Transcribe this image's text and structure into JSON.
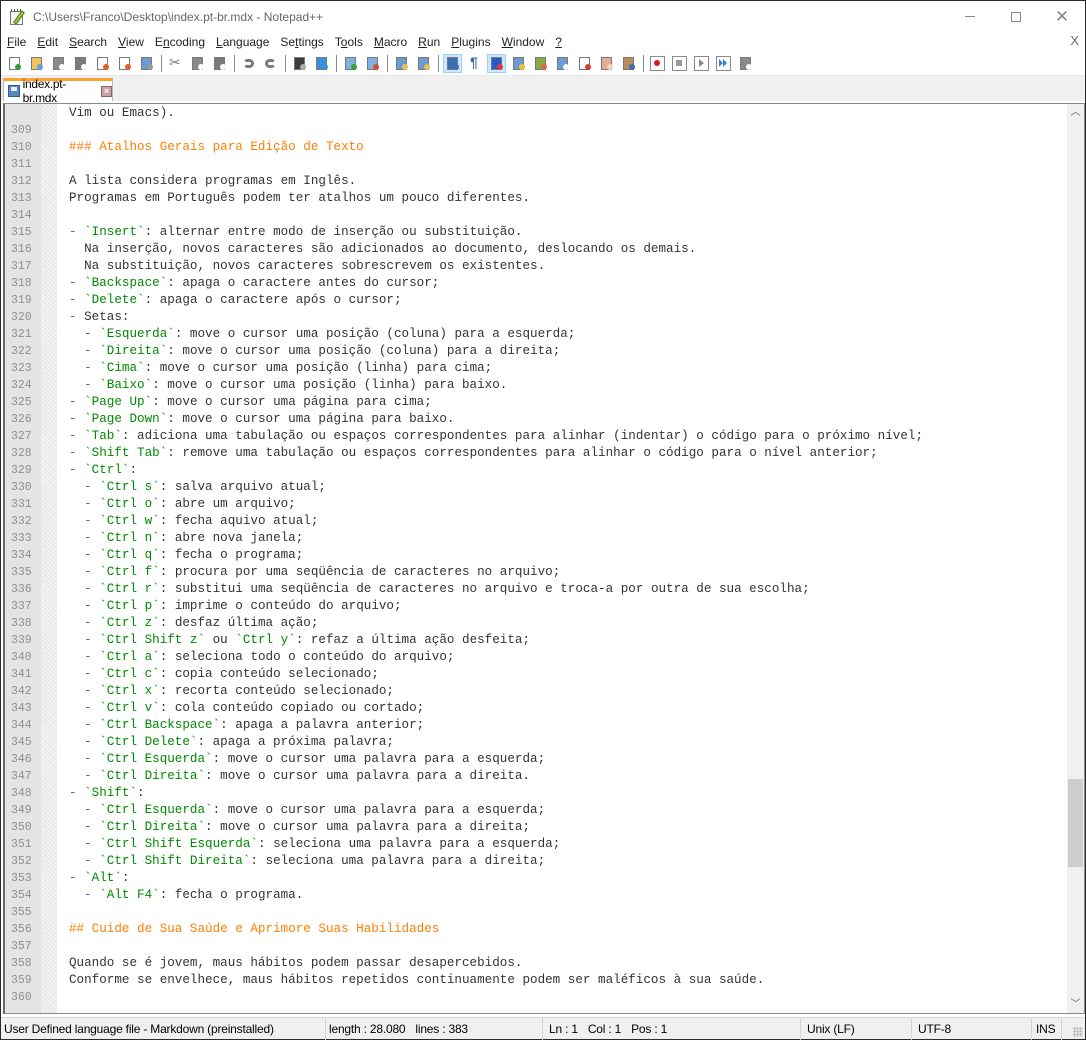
{
  "window": {
    "title": "C:\\Users\\Franco\\Desktop\\index.pt-br.mdx - Notepad++",
    "controls": [
      "minimize",
      "maximize",
      "close"
    ]
  },
  "menubar": {
    "items": [
      {
        "label": "File",
        "key": "F"
      },
      {
        "label": "Edit",
        "key": "E"
      },
      {
        "label": "Search",
        "key": "S"
      },
      {
        "label": "View",
        "key": "V"
      },
      {
        "label": "Encoding",
        "key": "n"
      },
      {
        "label": "Language",
        "key": "L"
      },
      {
        "label": "Settings",
        "key": "t"
      },
      {
        "label": "Tools",
        "key": "o"
      },
      {
        "label": "Macro",
        "key": "M"
      },
      {
        "label": "Run",
        "key": "R"
      },
      {
        "label": "Plugins",
        "key": "P"
      },
      {
        "label": "Window",
        "key": "W"
      },
      {
        "label": "?",
        "key": "?"
      }
    ],
    "close_label": "X"
  },
  "toolbar": {
    "groups": [
      [
        "new-file",
        "open-file",
        "save",
        "save-all",
        "close",
        "close-all",
        "print"
      ],
      [
        "cut",
        "copy",
        "paste"
      ],
      [
        "undo",
        "redo"
      ],
      [
        "find",
        "replace"
      ],
      [
        "zoom-in",
        "zoom-out"
      ],
      [
        "sync-vertical",
        "sync-horizontal"
      ],
      [
        "word-wrap",
        "show-all-characters",
        "indent-guide",
        "user-defined-language",
        "document-map",
        "document-list",
        "function-list",
        "folder-as-workspace",
        "monitoring"
      ],
      [
        "record-macro",
        "stop-recording",
        "playback-macro",
        "run-macro-multiple",
        "save-macro"
      ]
    ],
    "active": [
      "word-wrap",
      "indent-guide"
    ]
  },
  "tabs": [
    {
      "label": "index.pt-br.mdx",
      "icon": "save-icon",
      "active": true
    }
  ],
  "editor": {
    "colors": {
      "heading": "#ff7f00",
      "code": "#008a00",
      "dash": "#5b54d9",
      "text": "#222222",
      "line_number": "#8f8f8f"
    },
    "lines": [
      {
        "n": "",
        "tokens": [
          {
            "t": "p",
            "v": "Vim ou Emacs)."
          }
        ]
      },
      {
        "n": "309",
        "tokens": []
      },
      {
        "n": "310",
        "tokens": [
          {
            "t": "h",
            "v": "### Atalhos Gerais para Edição de Texto"
          }
        ]
      },
      {
        "n": "311",
        "tokens": []
      },
      {
        "n": "312",
        "tokens": [
          {
            "t": "p",
            "v": "A lista considera programas em Inglês."
          }
        ]
      },
      {
        "n": "313",
        "tokens": [
          {
            "t": "p",
            "v": "Programas em Português podem ter atalhos um pouco diferentes."
          }
        ]
      },
      {
        "n": "314",
        "tokens": []
      },
      {
        "n": "315",
        "tokens": [
          {
            "t": "d",
            "v": "- "
          },
          {
            "t": "c",
            "v": "`Insert`"
          },
          {
            "t": "p",
            "v": ": alternar entre modo de inserção ou substituição."
          }
        ]
      },
      {
        "n": "316",
        "tokens": [
          {
            "t": "p",
            "v": "  Na inserção, novos caracteres são adicionados ao documento, deslocando os demais."
          }
        ]
      },
      {
        "n": "317",
        "tokens": [
          {
            "t": "p",
            "v": "  Na substituição, novos caracteres sobrescrevem os existentes."
          }
        ]
      },
      {
        "n": "318",
        "tokens": [
          {
            "t": "d",
            "v": "- "
          },
          {
            "t": "c",
            "v": "`Backspace`"
          },
          {
            "t": "p",
            "v": ": apaga o caractere antes do cursor;"
          }
        ]
      },
      {
        "n": "319",
        "tokens": [
          {
            "t": "d",
            "v": "- "
          },
          {
            "t": "c",
            "v": "`Delete`"
          },
          {
            "t": "p",
            "v": ": apaga o caractere após o cursor;"
          }
        ]
      },
      {
        "n": "320",
        "tokens": [
          {
            "t": "d",
            "v": "- "
          },
          {
            "t": "p",
            "v": "Setas:"
          }
        ]
      },
      {
        "n": "321",
        "tokens": [
          {
            "t": "d",
            "v": "  - "
          },
          {
            "t": "c",
            "v": "`Esquerda`"
          },
          {
            "t": "p",
            "v": ": move o cursor uma posição (coluna) para a esquerda;"
          }
        ]
      },
      {
        "n": "322",
        "tokens": [
          {
            "t": "d",
            "v": "  - "
          },
          {
            "t": "c",
            "v": "`Direita`"
          },
          {
            "t": "p",
            "v": ": move o cursor uma posição (coluna) para a direita;"
          }
        ]
      },
      {
        "n": "323",
        "tokens": [
          {
            "t": "d",
            "v": "  - "
          },
          {
            "t": "c",
            "v": "`Cima`"
          },
          {
            "t": "p",
            "v": ": move o cursor uma posição (linha) para cima;"
          }
        ]
      },
      {
        "n": "324",
        "tokens": [
          {
            "t": "d",
            "v": "  - "
          },
          {
            "t": "c",
            "v": "`Baixo`"
          },
          {
            "t": "p",
            "v": ": move o cursor uma posição (linha) para baixo."
          }
        ]
      },
      {
        "n": "325",
        "tokens": [
          {
            "t": "d",
            "v": "- "
          },
          {
            "t": "c",
            "v": "`Page Up`"
          },
          {
            "t": "p",
            "v": ": move o cursor uma página para cima;"
          }
        ]
      },
      {
        "n": "326",
        "tokens": [
          {
            "t": "d",
            "v": "- "
          },
          {
            "t": "c",
            "v": "`Page Down`"
          },
          {
            "t": "p",
            "v": ": move o cursor uma página para baixo."
          }
        ]
      },
      {
        "n": "327",
        "tokens": [
          {
            "t": "d",
            "v": "- "
          },
          {
            "t": "c",
            "v": "`Tab`"
          },
          {
            "t": "p",
            "v": ": adiciona uma tabulação ou espaços correspondentes para alinhar (indentar) o código para o próximo nível;"
          }
        ]
      },
      {
        "n": "328",
        "tokens": [
          {
            "t": "d",
            "v": "- "
          },
          {
            "t": "c",
            "v": "`Shift Tab`"
          },
          {
            "t": "p",
            "v": ": remove uma tabulação ou espaços correspondentes para alinhar o código para o nível anterior;"
          }
        ]
      },
      {
        "n": "329",
        "tokens": [
          {
            "t": "d",
            "v": "- "
          },
          {
            "t": "c",
            "v": "`Ctrl`"
          },
          {
            "t": "p",
            "v": ":"
          }
        ]
      },
      {
        "n": "330",
        "tokens": [
          {
            "t": "d",
            "v": "  - "
          },
          {
            "t": "c",
            "v": "`Ctrl s`"
          },
          {
            "t": "p",
            "v": ": salva arquivo atual;"
          }
        ]
      },
      {
        "n": "331",
        "tokens": [
          {
            "t": "d",
            "v": "  - "
          },
          {
            "t": "c",
            "v": "`Ctrl o`"
          },
          {
            "t": "p",
            "v": ": abre um arquivo;"
          }
        ]
      },
      {
        "n": "332",
        "tokens": [
          {
            "t": "d",
            "v": "  - "
          },
          {
            "t": "c",
            "v": "`Ctrl w`"
          },
          {
            "t": "p",
            "v": ": fecha aquivo atual;"
          }
        ]
      },
      {
        "n": "333",
        "tokens": [
          {
            "t": "d",
            "v": "  - "
          },
          {
            "t": "c",
            "v": "`Ctrl n`"
          },
          {
            "t": "p",
            "v": ": abre nova janela;"
          }
        ]
      },
      {
        "n": "334",
        "tokens": [
          {
            "t": "d",
            "v": "  - "
          },
          {
            "t": "c",
            "v": "`Ctrl q`"
          },
          {
            "t": "p",
            "v": ": fecha o programa;"
          }
        ]
      },
      {
        "n": "335",
        "tokens": [
          {
            "t": "d",
            "v": "  - "
          },
          {
            "t": "c",
            "v": "`Ctrl f`"
          },
          {
            "t": "p",
            "v": ": procura por uma seqüência de caracteres no arquivo;"
          }
        ]
      },
      {
        "n": "336",
        "tokens": [
          {
            "t": "d",
            "v": "  - "
          },
          {
            "t": "c",
            "v": "`Ctrl r`"
          },
          {
            "t": "p",
            "v": ": substitui uma seqüência de caracteres no arquivo e troca-a por outra de sua escolha;"
          }
        ]
      },
      {
        "n": "337",
        "tokens": [
          {
            "t": "d",
            "v": "  - "
          },
          {
            "t": "c",
            "v": "`Ctrl p`"
          },
          {
            "t": "p",
            "v": ": imprime o conteúdo do arquivo;"
          }
        ]
      },
      {
        "n": "338",
        "tokens": [
          {
            "t": "d",
            "v": "  - "
          },
          {
            "t": "c",
            "v": "`Ctrl z`"
          },
          {
            "t": "p",
            "v": ": desfaz última ação;"
          }
        ]
      },
      {
        "n": "339",
        "tokens": [
          {
            "t": "d",
            "v": "  - "
          },
          {
            "t": "c",
            "v": "`Ctrl Shift z`"
          },
          {
            "t": "p",
            "v": " ou "
          },
          {
            "t": "c",
            "v": "`Ctrl y`"
          },
          {
            "t": "p",
            "v": ": refaz a última ação desfeita;"
          }
        ]
      },
      {
        "n": "340",
        "tokens": [
          {
            "t": "d",
            "v": "  - "
          },
          {
            "t": "c",
            "v": "`Ctrl a`"
          },
          {
            "t": "p",
            "v": ": seleciona todo o conteúdo do arquivo;"
          }
        ]
      },
      {
        "n": "341",
        "tokens": [
          {
            "t": "d",
            "v": "  - "
          },
          {
            "t": "c",
            "v": "`Ctrl c`"
          },
          {
            "t": "p",
            "v": ": copia conteúdo selecionado;"
          }
        ]
      },
      {
        "n": "342",
        "tokens": [
          {
            "t": "d",
            "v": "  - "
          },
          {
            "t": "c",
            "v": "`Ctrl x`"
          },
          {
            "t": "p",
            "v": ": recorta conteúdo selecionado;"
          }
        ]
      },
      {
        "n": "343",
        "tokens": [
          {
            "t": "d",
            "v": "  - "
          },
          {
            "t": "c",
            "v": "`Ctrl v`"
          },
          {
            "t": "p",
            "v": ": cola conteúdo copiado ou cortado;"
          }
        ]
      },
      {
        "n": "344",
        "tokens": [
          {
            "t": "d",
            "v": "  - "
          },
          {
            "t": "c",
            "v": "`Ctrl Backspace`"
          },
          {
            "t": "p",
            "v": ": apaga a palavra anterior;"
          }
        ]
      },
      {
        "n": "345",
        "tokens": [
          {
            "t": "d",
            "v": "  - "
          },
          {
            "t": "c",
            "v": "`Ctrl Delete`"
          },
          {
            "t": "p",
            "v": ": apaga a próxima palavra;"
          }
        ]
      },
      {
        "n": "346",
        "tokens": [
          {
            "t": "d",
            "v": "  - "
          },
          {
            "t": "c",
            "v": "`Ctrl Esquerda`"
          },
          {
            "t": "p",
            "v": ": move o cursor uma palavra para a esquerda;"
          }
        ]
      },
      {
        "n": "347",
        "tokens": [
          {
            "t": "d",
            "v": "  - "
          },
          {
            "t": "c",
            "v": "`Ctrl Direita`"
          },
          {
            "t": "p",
            "v": ": move o cursor uma palavra para a direita."
          }
        ]
      },
      {
        "n": "348",
        "tokens": [
          {
            "t": "d",
            "v": "- "
          },
          {
            "t": "c",
            "v": "`Shift`"
          },
          {
            "t": "p",
            "v": ":"
          }
        ]
      },
      {
        "n": "349",
        "tokens": [
          {
            "t": "d",
            "v": "  - "
          },
          {
            "t": "c",
            "v": "`Ctrl Esquerda`"
          },
          {
            "t": "p",
            "v": ": move o cursor uma palavra para a esquerda;"
          }
        ]
      },
      {
        "n": "350",
        "tokens": [
          {
            "t": "d",
            "v": "  - "
          },
          {
            "t": "c",
            "v": "`Ctrl Direita`"
          },
          {
            "t": "p",
            "v": ": move o cursor uma palavra para a direita;"
          }
        ]
      },
      {
        "n": "351",
        "tokens": [
          {
            "t": "d",
            "v": "  - "
          },
          {
            "t": "c",
            "v": "`Ctrl Shift Esquerda`"
          },
          {
            "t": "p",
            "v": ": seleciona uma palavra para a esquerda;"
          }
        ]
      },
      {
        "n": "352",
        "tokens": [
          {
            "t": "d",
            "v": "  - "
          },
          {
            "t": "c",
            "v": "`Ctrl Shift Direita`"
          },
          {
            "t": "p",
            "v": ": seleciona uma palavra para a direita;"
          }
        ]
      },
      {
        "n": "353",
        "tokens": [
          {
            "t": "d",
            "v": "- "
          },
          {
            "t": "c",
            "v": "`Alt`"
          },
          {
            "t": "p",
            "v": ":"
          }
        ]
      },
      {
        "n": "354",
        "tokens": [
          {
            "t": "d",
            "v": "  - "
          },
          {
            "t": "c",
            "v": "`Alt F4`"
          },
          {
            "t": "p",
            "v": ": fecha o programa."
          }
        ]
      },
      {
        "n": "355",
        "tokens": []
      },
      {
        "n": "356",
        "tokens": [
          {
            "t": "h",
            "v": "## Cuide de Sua Saúde e Aprimore Suas Habilidades"
          }
        ]
      },
      {
        "n": "357",
        "tokens": []
      },
      {
        "n": "358",
        "tokens": [
          {
            "t": "p",
            "v": "Quando se é jovem, maus hábitos podem passar desapercebidos."
          }
        ]
      },
      {
        "n": "359",
        "tokens": [
          {
            "t": "p",
            "v": "Conforme se envelhece, maus hábitos repetidos continuamente podem ser maléficos à sua saúde."
          }
        ]
      },
      {
        "n": "360",
        "tokens": []
      }
    ]
  },
  "scrollbar": {
    "position_fraction": 0.8
  },
  "statusbar": {
    "language": "User Defined language file - Markdown (preinstalled)",
    "length": "length : 28.080",
    "lines": "lines : 383",
    "ln": "Ln : 1",
    "col": "Col : 1",
    "pos": "Pos : 1",
    "eol": "Unix (LF)",
    "encoding": "UTF-8",
    "mode": "INS"
  }
}
